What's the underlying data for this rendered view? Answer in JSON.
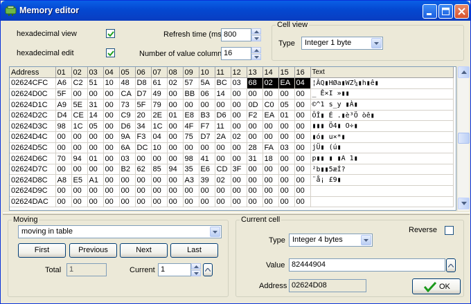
{
  "window": {
    "title": "Memory editor"
  },
  "options": {
    "hex_view_label": "hexadecimal view",
    "hex_edit_label": "hexadecimal edit",
    "refresh_label": "Refresh time (ms)",
    "refresh_value": "800",
    "columns_label": "Number of value columns",
    "columns_value": "16"
  },
  "cell_view": {
    "group_label": "Cell view",
    "type_label": "Type",
    "type_value": "Integer 1 byte"
  },
  "grid": {
    "headers": [
      "Address",
      "01",
      "02",
      "03",
      "04",
      "05",
      "06",
      "07",
      "08",
      "09",
      "10",
      "11",
      "12",
      "13",
      "14",
      "15",
      "16",
      "Text"
    ],
    "rows": [
      {
        "addr": "02624CFC",
        "bytes": [
          "A6",
          "C2",
          "51",
          "10",
          "48",
          "D8",
          "61",
          "02",
          "57",
          "5A",
          "BC",
          "03",
          "68",
          "02",
          "EA",
          "04"
        ],
        "text": "¦ÂQ▮HØa▮WZ¼▮h▮ê▮"
      },
      {
        "addr": "02624D0C",
        "bytes": [
          "5F",
          "00",
          "00",
          "00",
          "CA",
          "D7",
          "49",
          "00",
          "BB",
          "06",
          "14",
          "00",
          "00",
          "00",
          "00",
          "00"
        ],
        "text": "_   Ê×I »▮▮"
      },
      {
        "addr": "02624D1C",
        "bytes": [
          "A9",
          "5E",
          "31",
          "00",
          "73",
          "5F",
          "79",
          "00",
          "00",
          "00",
          "00",
          "00",
          "0D",
          "C0",
          "05",
          "00"
        ],
        "text": "©^1 s_y     ▮À▮"
      },
      {
        "addr": "02624D2C",
        "bytes": [
          "D4",
          "CE",
          "14",
          "00",
          "C9",
          "20",
          "2E",
          "01",
          "E8",
          "B3",
          "D6",
          "00",
          "F2",
          "EA",
          "01",
          "00"
        ],
        "text": "ÔÎ▮ É .▮è³Ö òê▮"
      },
      {
        "addr": "02624D3C",
        "bytes": [
          "98",
          "1C",
          "05",
          "00",
          "D6",
          "34",
          "1C",
          "00",
          "4F",
          "F7",
          "11",
          "00",
          "00",
          "00",
          "00",
          "00"
        ],
        "text": "▮▮▮ Ö4▮ O÷▮"
      },
      {
        "addr": "02624D4C",
        "bytes": [
          "00",
          "00",
          "00",
          "00",
          "9A",
          "F3",
          "04",
          "00",
          "75",
          "D7",
          "2A",
          "02",
          "00",
          "00",
          "00",
          "00"
        ],
        "text": "    ▮ó▮ u×*▮"
      },
      {
        "addr": "02624D5C",
        "bytes": [
          "00",
          "00",
          "00",
          "00",
          "6A",
          "DC",
          "10",
          "00",
          "00",
          "00",
          "00",
          "00",
          "28",
          "FA",
          "03",
          "00"
        ],
        "text": "    jÜ▮     (ú▮"
      },
      {
        "addr": "02624D6C",
        "bytes": [
          "70",
          "94",
          "01",
          "00",
          "03",
          "00",
          "00",
          "00",
          "98",
          "41",
          "00",
          "00",
          "31",
          "18",
          "00",
          "00"
        ],
        "text": "p▮▮ ▮   ▮A  1▮"
      },
      {
        "addr": "02624D7C",
        "bytes": [
          "00",
          "00",
          "00",
          "00",
          "B2",
          "62",
          "85",
          "94",
          "35",
          "E6",
          "CD",
          "3F",
          "00",
          "00",
          "00",
          "00"
        ],
        "text": "    ²b▮▮5æÍ?"
      },
      {
        "addr": "02624D8C",
        "bytes": [
          "A8",
          "E5",
          "A1",
          "00",
          "00",
          "00",
          "00",
          "00",
          "A3",
          "39",
          "02",
          "00",
          "00",
          "00",
          "00",
          "00"
        ],
        "text": "¨å¡     £9▮"
      },
      {
        "addr": "02624D9C",
        "bytes": [
          "00",
          "00",
          "00",
          "00",
          "00",
          "00",
          "00",
          "00",
          "00",
          "00",
          "00",
          "00",
          "00",
          "00",
          "00",
          "00"
        ],
        "text": ""
      },
      {
        "addr": "02624DAC",
        "bytes": [
          "00",
          "00",
          "00",
          "00",
          "00",
          "00",
          "00",
          "00",
          "00",
          "00",
          "00",
          "00",
          "00",
          "00",
          "00",
          "00"
        ],
        "text": ""
      }
    ]
  },
  "moving": {
    "group_label": "Moving",
    "mode_value": "moving in table",
    "first_label": "First",
    "previous_label": "Previous",
    "next_label": "Next",
    "last_label": "Last",
    "total_label": "Total",
    "total_value": "1",
    "current_label": "Current",
    "current_value": "1"
  },
  "current_cell": {
    "group_label": "Current cell",
    "reverse_label": "Reverse",
    "type_label": "Type",
    "type_value": "Integer 4 bytes",
    "value_label": "Value",
    "value_value": "82444904",
    "address_label": "Address",
    "address_value": "02624D08",
    "ok_label": "OK"
  }
}
